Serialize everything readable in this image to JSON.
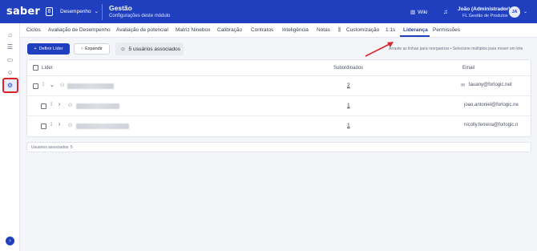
{
  "header": {
    "logo": "saber",
    "logo_badge": "8",
    "module": "Desempenho",
    "title": "Gestão",
    "subtitle": "Configurações deste módulo",
    "wiki_label": "Wiki",
    "user_name": "João (Administrador)",
    "user_company": "FL Gestão de Produtos",
    "avatar_initials": "JA"
  },
  "tabs": [
    "Ciclos",
    "Avaliação de Desempenho",
    "Avaliação de potencial",
    "Matriz Ninebox",
    "Calibração",
    "Contratos",
    "Inteligência",
    "Notas",
    "Customização",
    "1:1s",
    "Liderança",
    "Permissões"
  ],
  "active_tab": "Liderança",
  "toolbar": {
    "define_leader": "Definir Líder",
    "expand": "Expandir",
    "associated_users": "5 usuários associados",
    "hint": "Arraste as linhas para reorganizar • Selecione múltiplos para mover em lote"
  },
  "table": {
    "columns": {
      "leader": "Líder",
      "subordinates": "Subordinados",
      "email": "Email"
    },
    "rows": [
      {
        "subordinates": "2",
        "email": "tauany@forlogic.net"
      },
      {
        "subordinates": "1",
        "email": "joao.antoniel@forlogic.ne"
      },
      {
        "subordinates": "1",
        "email": "nicolly.ferreira@forlogic.n"
      }
    ]
  },
  "footer": {
    "text": "Usuários associados: 5"
  },
  "colors": {
    "brand": "#1f3fbf",
    "highlight": "#d9262c"
  }
}
